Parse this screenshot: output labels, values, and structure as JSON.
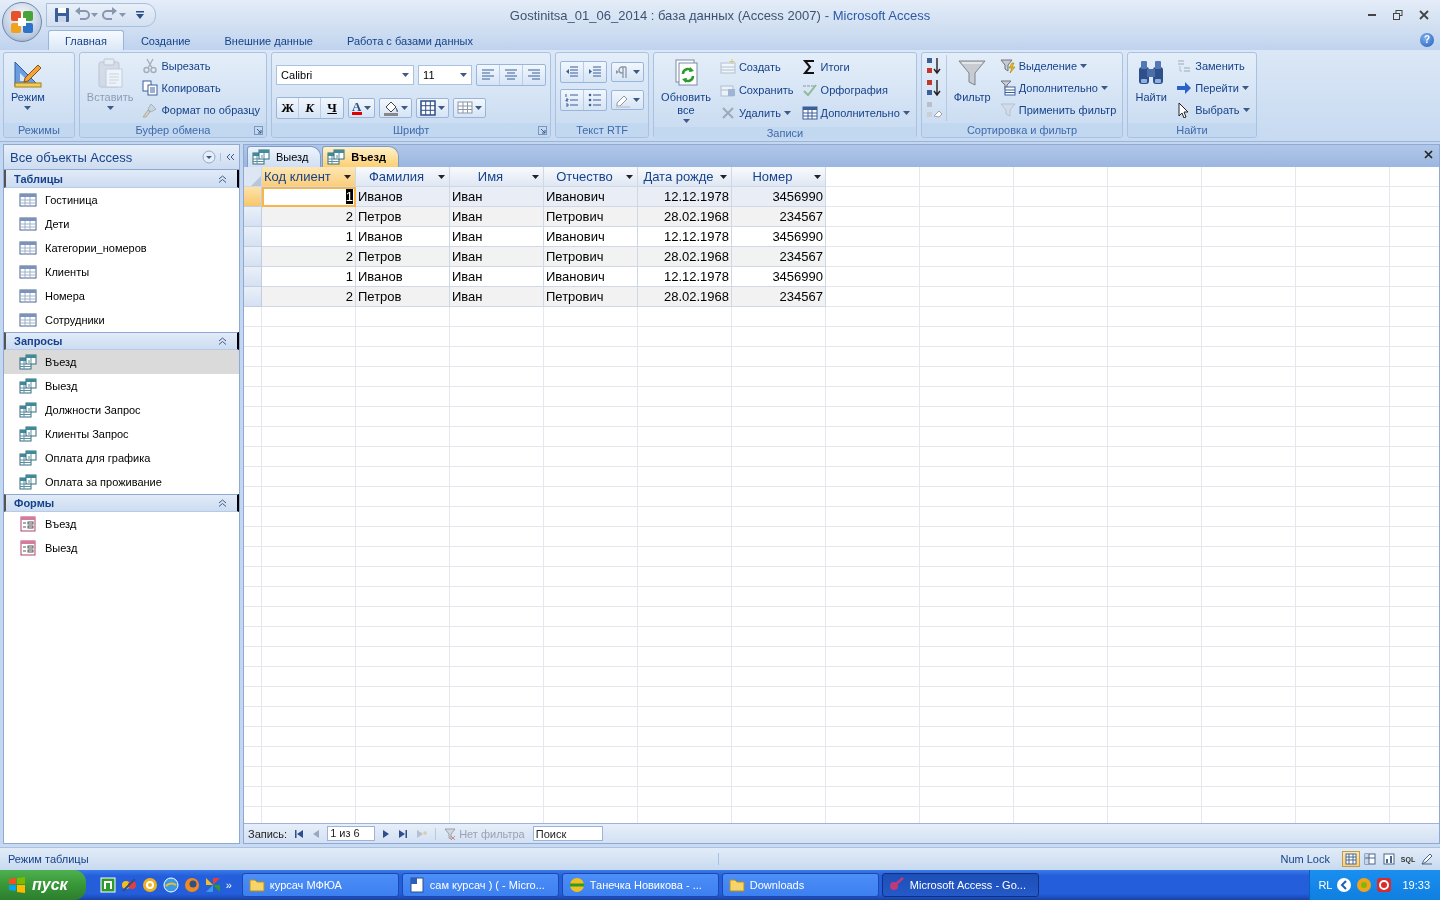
{
  "window": {
    "document_title": "Gostinitsa_01_06_2014 : база данных (Access 2007)",
    "app_title": "- Microsoft Access"
  },
  "ribbon_tabs": [
    {
      "label": "Главная",
      "selected": true
    },
    {
      "label": "Создание",
      "selected": false
    },
    {
      "label": "Внешние данные",
      "selected": false
    },
    {
      "label": "Работа с базами данных",
      "selected": false
    }
  ],
  "help": "?",
  "ribbon_groups": [
    {
      "label": "Режимы",
      "launcher": false,
      "columns": [
        {
          "kind": "large",
          "label": "Режим",
          "disabled": false,
          "dropdown": true
        }
      ]
    },
    {
      "label": "Буфер обмена",
      "launcher": true,
      "columns": [
        {
          "kind": "large",
          "label": "Вставить",
          "disabled": true,
          "dropdown": true
        },
        {
          "kind": "stack",
          "items": [
            {
              "label": "Вырезать",
              "disabled": true,
              "dropdown": false
            },
            {
              "label": "Копировать",
              "disabled": false,
              "dropdown": false
            },
            {
              "label": "Формат по образцу",
              "disabled": true,
              "dropdown": false
            }
          ]
        }
      ]
    },
    {
      "label": "Шрифт",
      "launcher": true,
      "columns": [
        {
          "kind": "font",
          "font": "Calibri",
          "size": "11",
          "styles": [
            "Ж",
            "К",
            "Ч",
            "А"
          ]
        }
      ]
    },
    {
      "label": "Текст RTF",
      "launcher": false,
      "columns": [
        {
          "kind": "rtf"
        }
      ]
    },
    {
      "label": "Записи",
      "launcher": false,
      "columns": [
        {
          "kind": "large",
          "label": "Обновить все",
          "disabled": false,
          "dropdown": true
        },
        {
          "kind": "stack",
          "items": [
            {
              "label": "Создать",
              "disabled": true,
              "dropdown": false
            },
            {
              "label": "Сохранить",
              "disabled": true,
              "dropdown": false
            },
            {
              "label": "Удалить",
              "disabled": true,
              "dropdown": true
            }
          ]
        },
        {
          "kind": "stack",
          "items": [
            {
              "label": "Итоги",
              "disabled": false,
              "dropdown": false
            },
            {
              "label": "Орфография",
              "disabled": true,
              "dropdown": false
            },
            {
              "label": "Дополнительно",
              "disabled": false,
              "dropdown": true
            }
          ]
        }
      ]
    },
    {
      "label": "Сортировка и фильтр",
      "launcher": false,
      "columns": [
        {
          "kind": "sort"
        },
        {
          "kind": "large",
          "label": "Фильтр",
          "disabled": false,
          "dropdown": false
        },
        {
          "kind": "stack",
          "items": [
            {
              "label": "Выделение",
              "disabled": false,
              "dropdown": true
            },
            {
              "label": "Дополнительно",
              "disabled": false,
              "dropdown": true
            },
            {
              "label": "Применить фильтр",
              "disabled": true,
              "dropdown": false
            }
          ]
        }
      ]
    },
    {
      "label": "Найти",
      "launcher": false,
      "columns": [
        {
          "kind": "large",
          "label": "Найти",
          "disabled": false,
          "dropdown": false
        },
        {
          "kind": "stack",
          "items": [
            {
              "label": "Заменить",
              "disabled": true,
              "dropdown": false
            },
            {
              "label": "Перейти",
              "disabled": false,
              "dropdown": true
            },
            {
              "label": "Выбрать",
              "disabled": false,
              "dropdown": true
            }
          ]
        }
      ]
    }
  ],
  "navigation_pane": {
    "title": "Все объекты Access",
    "sections": [
      {
        "title": "Таблицы",
        "kind": "table",
        "expanded": true,
        "items": [
          {
            "label": "Гостиница",
            "selected": false
          },
          {
            "label": "Дети",
            "selected": false
          },
          {
            "label": "Категории_номеров",
            "selected": false
          },
          {
            "label": "Клиенты",
            "selected": false
          },
          {
            "label": "Номера",
            "selected": false
          },
          {
            "label": "Сотрудники",
            "selected": false
          }
        ]
      },
      {
        "title": "Запросы",
        "kind": "query",
        "expanded": true,
        "items": [
          {
            "label": "Въезд",
            "selected": true
          },
          {
            "label": "Выезд",
            "selected": false
          },
          {
            "label": "Должности Запрос",
            "selected": false
          },
          {
            "label": "Клиенты Запрос",
            "selected": false
          },
          {
            "label": "Оплата для графика",
            "selected": false
          },
          {
            "label": "Оплата за проживание",
            "selected": false
          }
        ]
      },
      {
        "title": "Формы",
        "kind": "form",
        "expanded": true,
        "items": [
          {
            "label": "Въезд",
            "selected": false
          },
          {
            "label": "Выезд",
            "selected": false
          }
        ]
      }
    ]
  },
  "document_tabs": [
    {
      "label": "Выезд",
      "selected": false
    },
    {
      "label": "Въезд",
      "selected": true
    }
  ],
  "datasheet": {
    "columns": [
      {
        "label": "Код клиент",
        "kind": "number",
        "selected": true
      },
      {
        "label": "Фамилия",
        "kind": "text",
        "selected": false
      },
      {
        "label": "Имя",
        "kind": "text",
        "selected": false
      },
      {
        "label": "Отчество",
        "kind": "text",
        "selected": false
      },
      {
        "label": "Дата рожде",
        "kind": "number",
        "selected": false
      },
      {
        "label": "Номер",
        "kind": "number",
        "selected": false
      }
    ],
    "rows": [
      {
        "selected": true,
        "cells": [
          "1",
          "Иванов",
          "Иван",
          "Иванович",
          "12.12.1978",
          "3456990"
        ]
      },
      {
        "selected": false,
        "cells": [
          "2",
          "Петров",
          "Иван",
          "Петрович",
          "28.02.1968",
          "234567"
        ]
      },
      {
        "selected": false,
        "cells": [
          "1",
          "Иванов",
          "Иван",
          "Иванович",
          "12.12.1978",
          "3456990"
        ]
      },
      {
        "selected": false,
        "cells": [
          "2",
          "Петров",
          "Иван",
          "Петрович",
          "28.02.1968",
          "234567"
        ]
      },
      {
        "selected": false,
        "cells": [
          "1",
          "Иванов",
          "Иван",
          "Иванович",
          "12.12.1978",
          "3456990"
        ]
      },
      {
        "selected": false,
        "cells": [
          "2",
          "Петров",
          "Иван",
          "Петрович",
          "28.02.1968",
          "234567"
        ]
      }
    ]
  },
  "record_navigator": {
    "label": "Запись:",
    "position": "1 из 6",
    "filter": "Нет фильтра",
    "search_placeholder": "Поиск"
  },
  "status_bar": {
    "mode": "Режим таблицы",
    "indicator": "Num Lock",
    "views": [
      {
        "selected": true
      },
      {
        "selected": false
      },
      {
        "selected": false
      },
      {
        "selected": false,
        "label": "SQL"
      },
      {
        "selected": false
      }
    ]
  },
  "taskbar": {
    "start": "пуск",
    "more": "»",
    "tasks": [
      {
        "label": "курсач МФЮА",
        "selected": false
      },
      {
        "label": "сам курсач ) ( - Micro...",
        "selected": false
      },
      {
        "label": "Танечка Новикова - ...",
        "selected": false
      },
      {
        "label": "Downloads",
        "selected": false
      },
      {
        "label": "Microsoft Access - Go...",
        "selected": true
      }
    ],
    "language": "RL",
    "clock": "19:33"
  }
}
